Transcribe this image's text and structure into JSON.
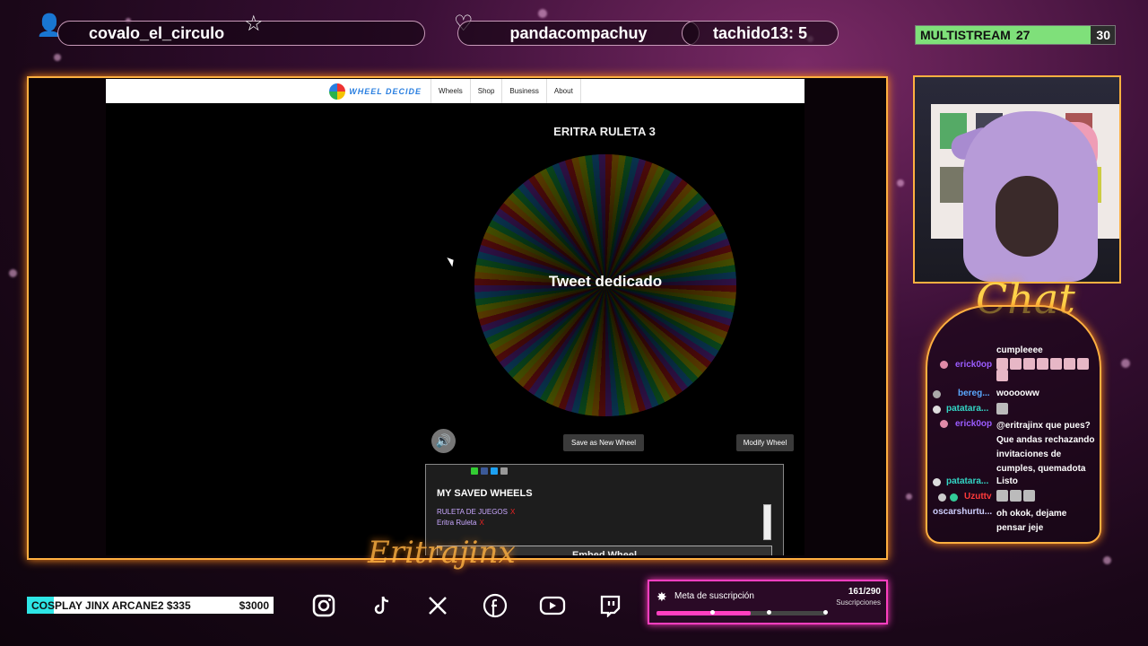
{
  "topbar": {
    "follower_name": "covalo_el_circulo",
    "sub_name": "pandacompachuy",
    "counter_text": "tachido13: 5",
    "multistream_label": "MULTISTREAM",
    "multistream_left": "27",
    "multistream_right": "30"
  },
  "site": {
    "logo_text": "WHEEL DECIDE",
    "nav": [
      "Wheels",
      "Shop",
      "Business",
      "About"
    ],
    "wheel_title": "ERITRA RULETA 3",
    "wheel_center_text": "Tweet dedicado",
    "save_button": "Save as New Wheel",
    "modify_button": "Modify Wheel",
    "saved_title": "MY SAVED WHEELS",
    "saved_wheels": [
      "RULETA DE JUEGOS",
      "Eritra Ruleta"
    ],
    "remove_mark": "X",
    "embed_button": "Embed Wheel"
  },
  "chat": {
    "title": "Chat",
    "messages": [
      {
        "user": "",
        "text": "cumpleeee",
        "user_color": "#ffffff"
      },
      {
        "user": "erick0op",
        "text": "",
        "user_color": "#9b5cff"
      },
      {
        "user": "bereg...",
        "text": "wooooww",
        "user_color": "#5aa8ff"
      },
      {
        "user": "patatara...",
        "text": "",
        "user_color": "#33d6c6"
      },
      {
        "user": "erick0op",
        "text": "@eritrajinx que pues? Que andas rechazando invitaciones de cumples, quemadota",
        "user_color": "#9b5cff"
      },
      {
        "user": "patatara...",
        "text": "Listo",
        "user_color": "#33d6c6"
      },
      {
        "user": "Uzuttv",
        "text": "",
        "user_color": "#ff3a3a"
      },
      {
        "user": "oscarshurtu...",
        "text": "oh okok, dejame pensar jeje",
        "user_color": "#cfcfff"
      }
    ]
  },
  "bottom": {
    "goal_text": "COSPLAY JINX ARCANE2 $335",
    "goal_target": "$3000",
    "goal_progress": 0.11,
    "social_icons": [
      "instagram-icon",
      "tiktok-icon",
      "x-icon",
      "facebook-icon",
      "youtube-icon",
      "twitch-icon"
    ],
    "sub_goal_label": "Meta de suscripción",
    "sub_goal_count": "161/290",
    "sub_goal_unit": "Suscripciones",
    "sub_goal_progress": 0.555
  },
  "colors": {
    "accent_orange": "#ffb040",
    "accent_pink": "#ff3fc0",
    "multistream_green": "#7fe07a"
  }
}
